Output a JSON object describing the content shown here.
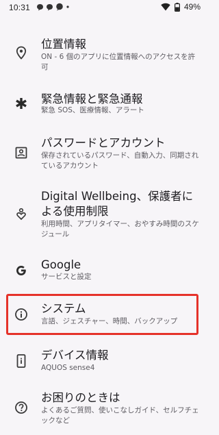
{
  "status_bar": {
    "time": "10:31",
    "battery": "49%"
  },
  "items": [
    {
      "title": "位置情報",
      "subtitle": "ON - 6 個のアプリに位置情報へのアクセスを許可",
      "icon": "location-pin-icon"
    },
    {
      "title": "緊急情報と緊急通報",
      "subtitle": "緊急 SOS、医療情報、アラート",
      "icon": "asterisk-icon"
    },
    {
      "title": "パスワードとアカウント",
      "subtitle": "保存されているパスワード、自動入力、同期されているアカウント",
      "icon": "account-box-icon"
    },
    {
      "title": "Digital Wellbeing、保護者による使用制限",
      "subtitle": "利用時間、アプリタイマー、おやすみ時間のスケジュール",
      "icon": "wellbeing-heart-icon"
    },
    {
      "title": "Google",
      "subtitle": "サービスと設定",
      "icon": "google-g-icon"
    },
    {
      "title": "システム",
      "subtitle": "言語、ジェスチャー、時間、バックアップ",
      "icon": "info-icon"
    },
    {
      "title": "デバイス情報",
      "subtitle": "AQUOS sense4",
      "icon": "phone-info-icon"
    },
    {
      "title": "お困りのときは",
      "subtitle": "よくあるご質問、使いこなしガイド、セルフチェックなど",
      "icon": "help-icon"
    }
  ],
  "colors": {
    "background": "#f7f5f8",
    "highlight": "#e5322a",
    "subtitle": "#5c5a60"
  }
}
